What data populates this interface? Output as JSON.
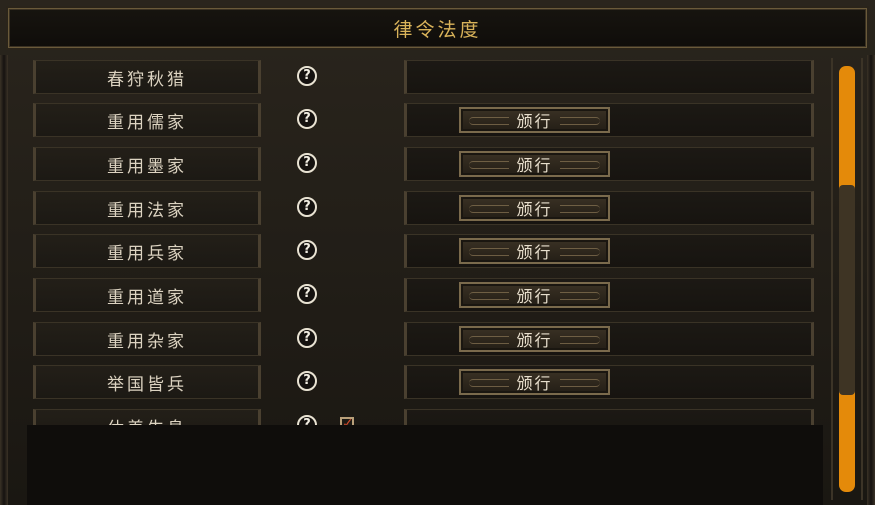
{
  "title": "律令法度",
  "rows": [
    {
      "name": "春狩秋猎",
      "help": "?",
      "button": ""
    },
    {
      "name": "重用儒家",
      "help": "?",
      "button": "颁行"
    },
    {
      "name": "重用墨家",
      "help": "?",
      "button": "颁行"
    },
    {
      "name": "重用法家",
      "help": "?",
      "button": "颁行"
    },
    {
      "name": "重用兵家",
      "help": "?",
      "button": "颁行"
    },
    {
      "name": "重用道家",
      "help": "?",
      "button": "颁行"
    },
    {
      "name": "重用杂家",
      "help": "?",
      "button": "颁行"
    },
    {
      "name": "举国皆兵",
      "help": "?",
      "button": "颁行"
    },
    {
      "name": "休养生息",
      "help": "?",
      "button": ""
    }
  ],
  "scrollbar": {
    "position_fraction": 0.28
  },
  "colors": {
    "accent": "#e48a0a",
    "title": "#d9b35a",
    "background": "#1d1a15"
  }
}
